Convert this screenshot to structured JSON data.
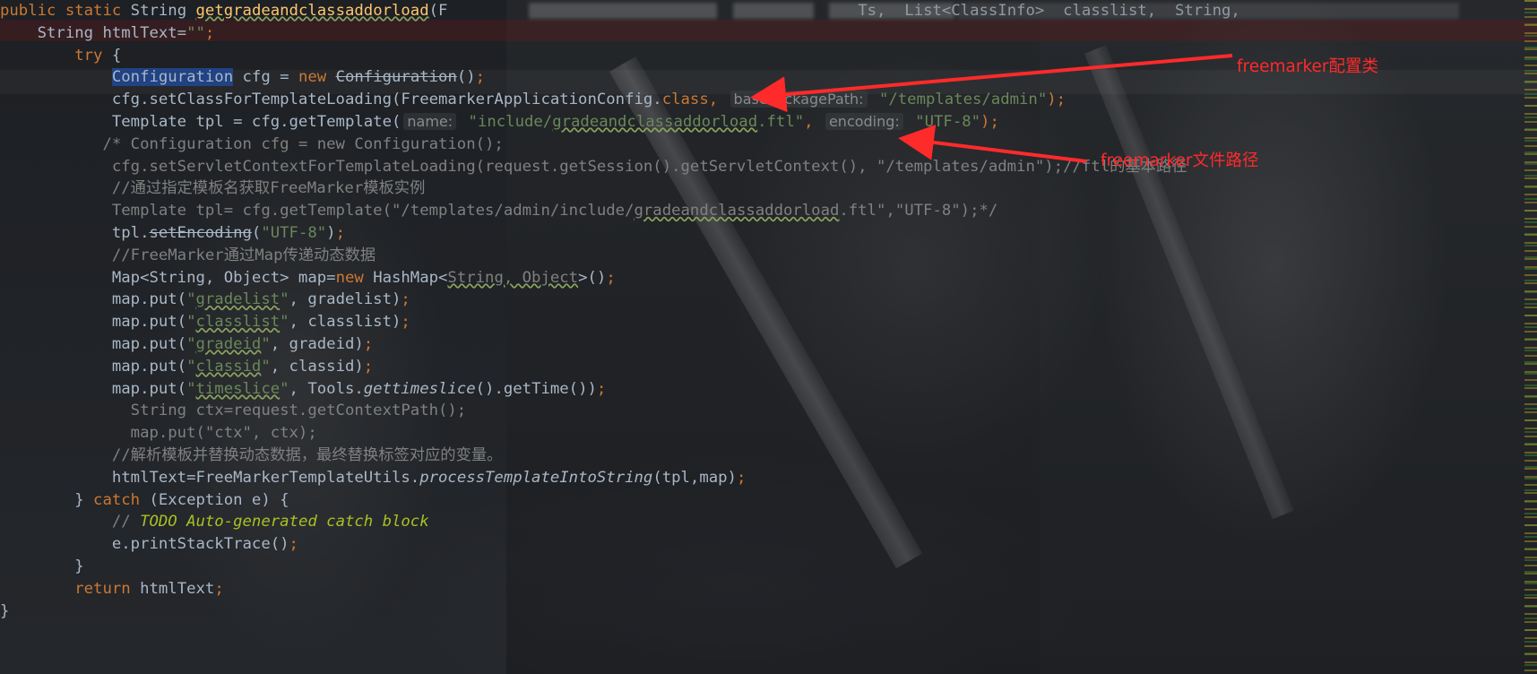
{
  "editor": {
    "lines": [
      [
        {
          "t": "public static ",
          "c": "kw"
        },
        {
          "t": "String ",
          "c": ""
        },
        {
          "t": "getgradeandclassaddorload",
          "c": "fn ul"
        },
        {
          "t": "(F",
          "c": ""
        }
      ],
      [
        {
          "t": "    String htmlText=",
          "c": ""
        },
        {
          "t": "\"\"",
          "c": "str"
        },
        {
          "t": ";",
          "c": "kw"
        }
      ],
      [
        {
          "t": "        try ",
          "c": "kw"
        },
        {
          "t": "{",
          "c": ""
        }
      ],
      [
        {
          "t": "            ",
          "c": ""
        },
        {
          "t": "Configuration",
          "c": "sel"
        },
        {
          "t": " cfg = ",
          "c": ""
        },
        {
          "t": "new ",
          "c": "kw"
        },
        {
          "t": "Configuration",
          "c": "strike"
        },
        {
          "t": "()",
          "c": ""
        },
        {
          "t": ";",
          "c": "kw"
        }
      ],
      [
        {
          "t": "            cfg.setClassForTemplateLoading(FreemarkerApplicationConfig.",
          "c": ""
        },
        {
          "t": "class",
          "c": "kw"
        },
        {
          "t": ", ",
          "c": "kw"
        },
        {
          "t": "basePackagePath:",
          "c": "hint"
        },
        {
          "t": " \"/templates/admin\"",
          "c": "str"
        },
        {
          "t": ");",
          "c": "kw"
        }
      ],
      [
        {
          "t": "            Template tpl = cfg.getTemplate(",
          "c": ""
        },
        {
          "t": "name:",
          "c": "hint"
        },
        {
          "t": " \"include/",
          "c": "str"
        },
        {
          "t": "gradeandclassaddorload",
          "c": "str ul"
        },
        {
          "t": ".ftl\"",
          "c": "str"
        },
        {
          "t": ", ",
          "c": "kw"
        },
        {
          "t": "encoding:",
          "c": "hint"
        },
        {
          "t": " \"UTF-8\"",
          "c": "str"
        },
        {
          "t": ");",
          "c": "kw"
        }
      ],
      [
        {
          "t": "           /* Configuration cfg = new Configuration();",
          "c": "gray"
        }
      ],
      [
        {
          "t": "            cfg.setServletContextForTemplateLoading(request.getSession().getServletContext(), \"/templates/admin\");//ftl的基本路径",
          "c": "gray"
        }
      ],
      [
        {
          "t": "            //通过指定模板名获取FreeMarker模板实例",
          "c": "gray"
        }
      ],
      [
        {
          "t": "            Template tpl= cfg.getTemplate(\"/templates/admin/include/",
          "c": "gray"
        },
        {
          "t": "gradeandclassaddorload",
          "c": "gray ul"
        },
        {
          "t": ".ftl\",\"UTF-8\");*/",
          "c": "gray"
        }
      ],
      [
        {
          "t": "            tpl.",
          "c": ""
        },
        {
          "t": "setEncoding",
          "c": "strike"
        },
        {
          "t": "(",
          "c": ""
        },
        {
          "t": "\"UTF-8\"",
          "c": "str"
        },
        {
          "t": ")",
          "c": ""
        },
        {
          "t": ";",
          "c": "kw"
        }
      ],
      [
        {
          "t": "            //FreeMarker通过Map传递动态数据",
          "c": "gray"
        }
      ],
      [
        {
          "t": "            Map<String, Object> map=",
          "c": ""
        },
        {
          "t": "new ",
          "c": "kw"
        },
        {
          "t": "HashMap<",
          "c": ""
        },
        {
          "t": "String, Object",
          "c": "gray ul"
        },
        {
          "t": ">()",
          "c": ""
        },
        {
          "t": ";",
          "c": "kw"
        }
      ],
      [
        {
          "t": "            map.put(",
          "c": ""
        },
        {
          "t": "\"",
          "c": "str"
        },
        {
          "t": "gradelist",
          "c": "str ul"
        },
        {
          "t": "\"",
          "c": "str"
        },
        {
          "t": ", gradelist)",
          "c": ""
        },
        {
          "t": ";",
          "c": "kw"
        }
      ],
      [
        {
          "t": "            map.put(",
          "c": ""
        },
        {
          "t": "\"",
          "c": "str"
        },
        {
          "t": "classlist",
          "c": "str ul"
        },
        {
          "t": "\"",
          "c": "str"
        },
        {
          "t": ", classlist)",
          "c": ""
        },
        {
          "t": ";",
          "c": "kw"
        }
      ],
      [
        {
          "t": "            map.put(",
          "c": ""
        },
        {
          "t": "\"",
          "c": "str"
        },
        {
          "t": "gradeid",
          "c": "str ul"
        },
        {
          "t": "\"",
          "c": "str"
        },
        {
          "t": ", gradeid)",
          "c": ""
        },
        {
          "t": ";",
          "c": "kw"
        }
      ],
      [
        {
          "t": "            map.put(",
          "c": ""
        },
        {
          "t": "\"",
          "c": "str"
        },
        {
          "t": "classid",
          "c": "str ul"
        },
        {
          "t": "\"",
          "c": "str"
        },
        {
          "t": ", classid)",
          "c": ""
        },
        {
          "t": ";",
          "c": "kw"
        }
      ],
      [
        {
          "t": "            map.put(",
          "c": ""
        },
        {
          "t": "\"",
          "c": "str"
        },
        {
          "t": "timeslice",
          "c": "str ul"
        },
        {
          "t": "\"",
          "c": "str"
        },
        {
          "t": ", Tools.",
          "c": ""
        },
        {
          "t": "gettimeslice",
          "c": "it"
        },
        {
          "t": "().getTime())",
          "c": ""
        },
        {
          "t": ";",
          "c": "kw"
        }
      ],
      [
        {
          "t": "              String ctx=request.getContextPath();",
          "c": "gray"
        }
      ],
      [
        {
          "t": "              map.put(\"ctx\", ctx);",
          "c": "gray"
        }
      ],
      [
        {
          "t": "            //解析模板并替换动态数据，最终替换标签对应的变量。",
          "c": "gray"
        }
      ],
      [
        {
          "t": "            htmlText=FreeMarkerTemplateUtils.",
          "c": ""
        },
        {
          "t": "processTemplateIntoString",
          "c": "it"
        },
        {
          "t": "(tpl,map)",
          "c": ""
        },
        {
          "t": ";",
          "c": "kw"
        }
      ],
      [
        {
          "t": "        } ",
          "c": ""
        },
        {
          "t": "catch ",
          "c": "kw"
        },
        {
          "t": "(Exception e) {",
          "c": ""
        }
      ],
      [
        {
          "t": "            // ",
          "c": "gray"
        },
        {
          "t": "TODO Auto-generated catch block",
          "c": "todo"
        }
      ],
      [
        {
          "t": "            e.printStackTrace()",
          "c": ""
        },
        {
          "t": ";",
          "c": "kw"
        }
      ],
      [
        {
          "t": "        }",
          "c": ""
        }
      ],
      [
        {
          "t": "        return ",
          "c": "kw"
        },
        {
          "t": "htmlText",
          "c": ""
        },
        {
          "t": ";",
          "c": "kw"
        }
      ],
      [
        {
          "t": "}",
          "c": ""
        }
      ]
    ],
    "line1_tail": "Ts,  List<ClassInfo>  classlist,  String",
    "line1_end": ",  "
  },
  "annotations": {
    "config_class": "freemarker配置类",
    "file_path": "freemarker文件路径",
    "color": "#ff2a2a"
  },
  "theme": {
    "keyword": "#cc7832",
    "string": "#6a8759",
    "comment": "#808080",
    "text": "#a9b7c6",
    "selection": "#214283"
  }
}
